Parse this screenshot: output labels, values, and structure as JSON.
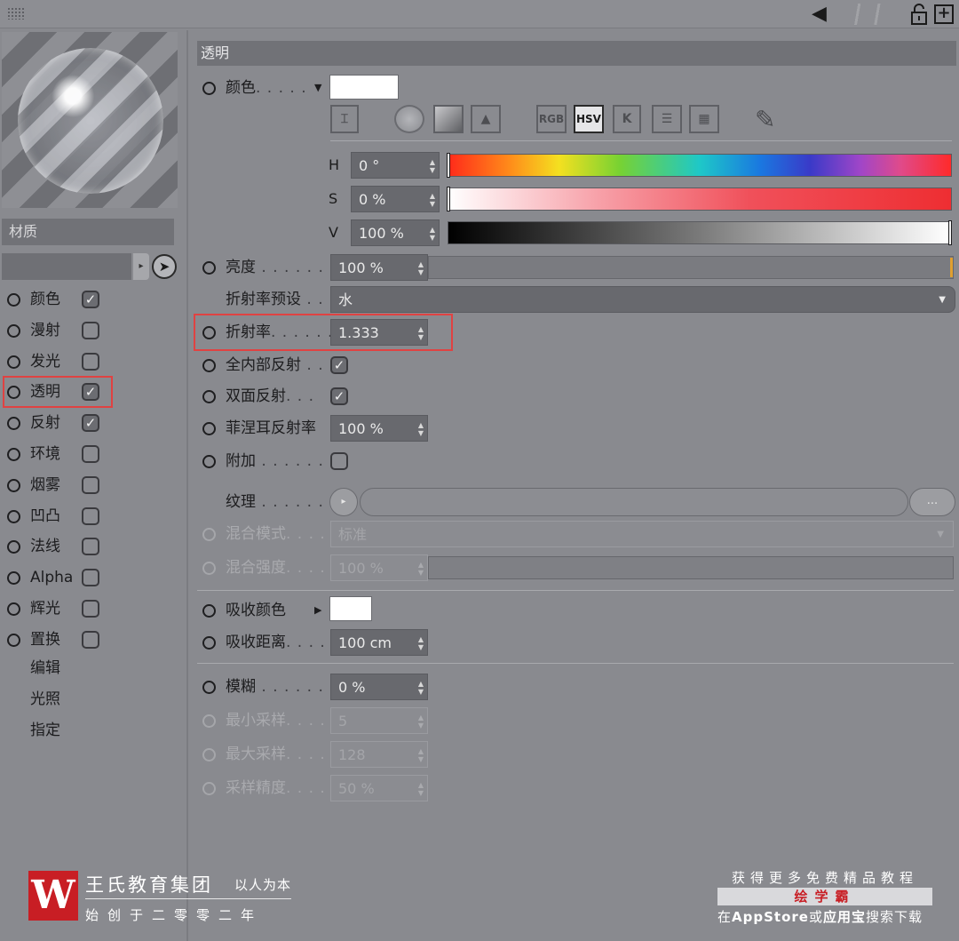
{
  "top_bar": {
    "grip_icon": "grip-dots-icon",
    "icons": [
      "back-arrow-icon",
      "lock-icon",
      "new-window-icon"
    ]
  },
  "left_panel": {
    "header": "材质",
    "channels": [
      {
        "label": "颜色",
        "checked": true
      },
      {
        "label": "漫射",
        "checked": false
      },
      {
        "label": "发光",
        "checked": false
      },
      {
        "label": "透明",
        "checked": true,
        "highlighted": true
      },
      {
        "label": "反射",
        "checked": true
      },
      {
        "label": "环境",
        "checked": false
      },
      {
        "label": "烟雾",
        "checked": false
      },
      {
        "label": "凹凸",
        "checked": false
      },
      {
        "label": "法线",
        "checked": false
      },
      {
        "label": "Alpha",
        "checked": false
      },
      {
        "label": "辉光",
        "checked": false
      },
      {
        "label": "置换",
        "checked": false
      }
    ],
    "extra_items": [
      "编辑",
      "光照",
      "指定"
    ]
  },
  "right_panel": {
    "section_title": "透明",
    "color": {
      "label": "颜色",
      "dots": ". . . . . ",
      "swatch": "#ffffff"
    },
    "color_modes": [
      "RGB",
      "HSV",
      "K"
    ],
    "active_mode": "HSV",
    "h": {
      "label": "H",
      "value": "0 °"
    },
    "s": {
      "label": "S",
      "value": "0 %"
    },
    "v": {
      "label": "V",
      "value": "100 %"
    },
    "brightness": {
      "label": "亮度",
      "dots": " . . . . . . . ",
      "value": "100 %"
    },
    "ior_preset": {
      "label": "折射率预设",
      "dots": " . .",
      "value": "水"
    },
    "ior": {
      "label": "折射率",
      "dots": ". . . . . . ",
      "value": "1.333"
    },
    "total_internal": {
      "label": "全内部反射",
      "dots": " . . ",
      "checked": true
    },
    "double_sided": {
      "label": "双面反射",
      "dots": ". . . ",
      "checked": true
    },
    "fresnel": {
      "label": "菲涅耳反射率",
      "value": "100 %"
    },
    "additive": {
      "label": "附加",
      "dots": " . . . . . . . .",
      "checked": false
    },
    "texture": {
      "label": "纹理",
      "dots": " . . . . . . . .",
      "more": "..."
    },
    "blend_mode": {
      "label": "混合模式",
      "dots": ". . . . .",
      "value": "标准"
    },
    "blend_strength": {
      "label": "混合强度",
      "dots": ". . . .",
      "value": "100 %"
    },
    "absorb_color": {
      "label": "吸收颜色",
      "swatch": "#ffffff"
    },
    "absorb_distance": {
      "label": "吸收距离",
      "dots": ". . . .",
      "value": "100 cm"
    },
    "blur": {
      "label": "模糊",
      "dots": " . . . . . . . .",
      "value": "0 %"
    },
    "min_samples": {
      "label": "最小采样",
      "dots": ". . . . .",
      "value": "5"
    },
    "max_samples": {
      "label": "最大采样",
      "dots": ". . . . .",
      "value": "128"
    },
    "sample_accuracy": {
      "label": "采样精度",
      "dots": ". . . . .",
      "value": "50 %"
    }
  },
  "watermark": {
    "logo_letter": "W",
    "name": "王氏教育集团",
    "motto": "以人为本",
    "sub": "始创于二零零二年",
    "promo_line1": "获得更多免费精品教程",
    "promo_line2": "绘学霸",
    "promo_line3_pre": "在",
    "promo_line3_store": "AppStore",
    "promo_line3_or": "或",
    "promo_line3_app": "应用宝",
    "promo_line3_post": "搜索下载"
  }
}
